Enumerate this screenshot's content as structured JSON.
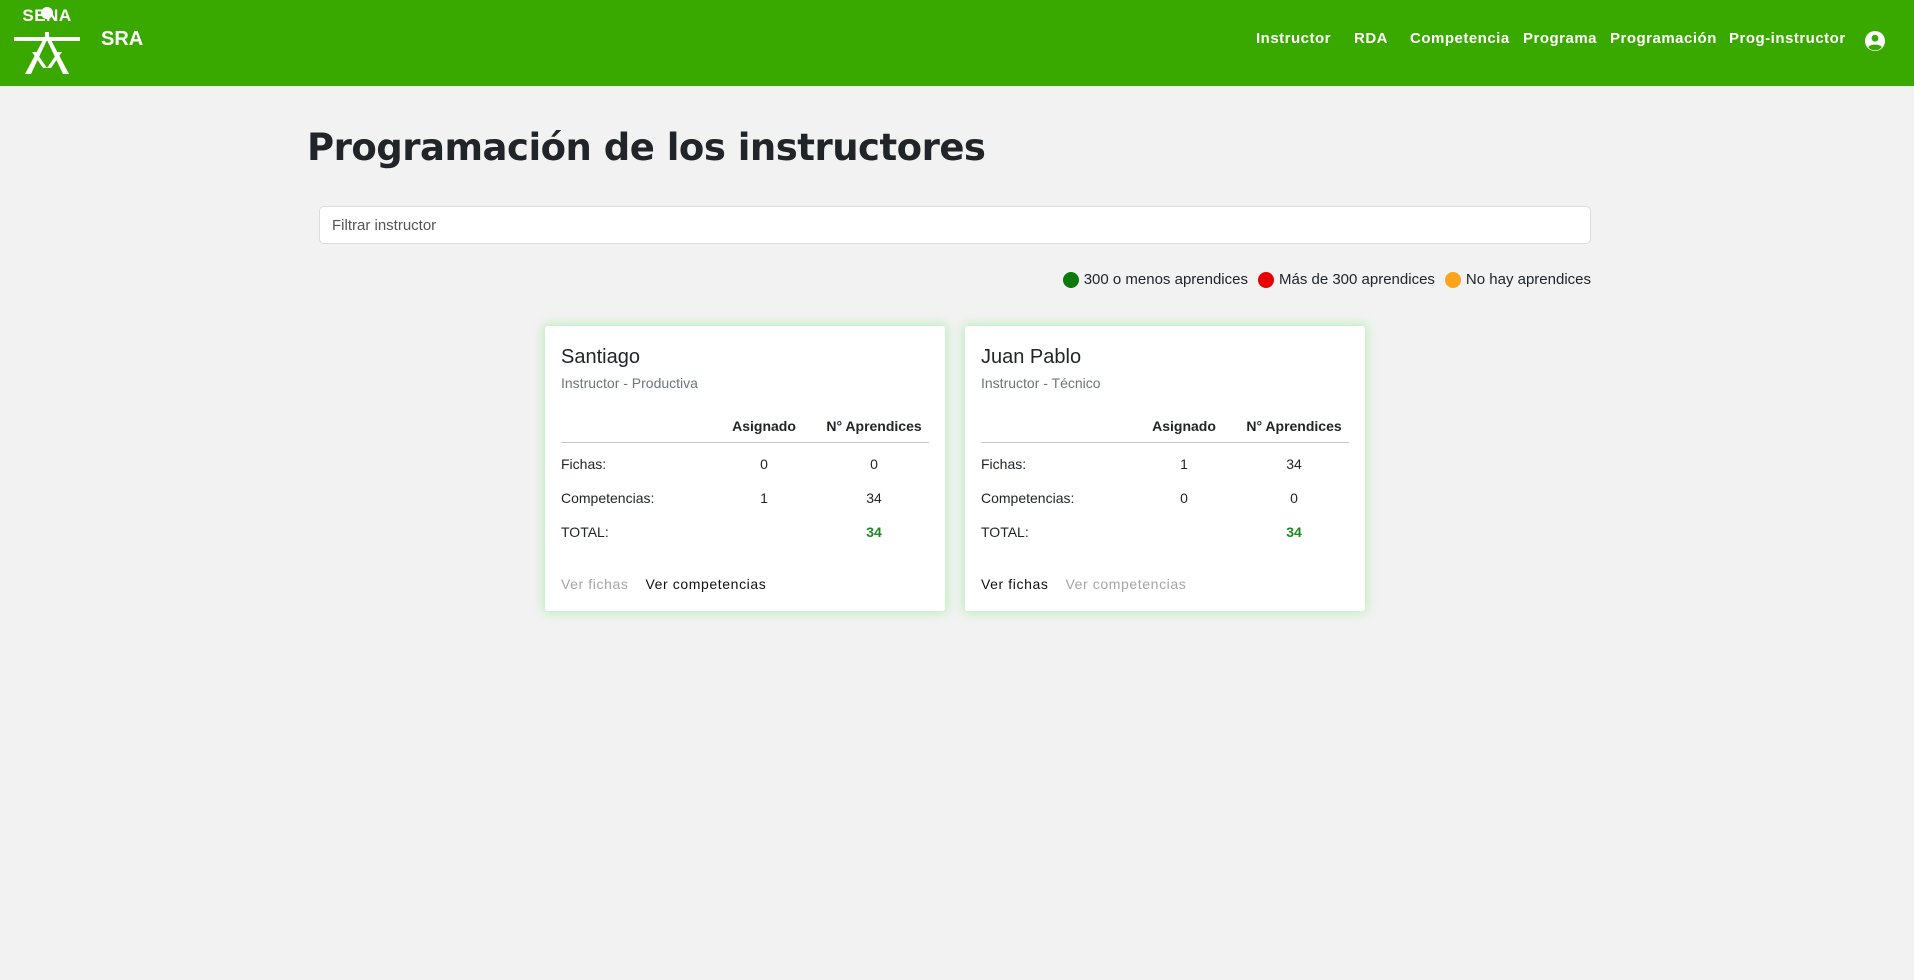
{
  "app": {
    "logo_text": "SENA",
    "brand": "SRA",
    "nav": [
      "Instructor",
      "RDA",
      "Competencia",
      "Programa",
      "Programación",
      "Prog-instructor"
    ]
  },
  "page": {
    "title": "Programación de los instructores",
    "filter_placeholder": "Filtrar instructor",
    "filter_value": ""
  },
  "legend": [
    {
      "label": "300 o menos aprendices",
      "color": "#0b7a0b"
    },
    {
      "label": "Más de 300 aprendices",
      "color": "#e80000"
    },
    {
      "label": "No hay aprendices",
      "color": "#ffa31a"
    }
  ],
  "table_headers": [
    "",
    "Asignado",
    "N° Aprendices"
  ],
  "cards": [
    {
      "name": "Santiago",
      "role": "Instructor - Productiva",
      "rows": [
        {
          "label": "Fichas:",
          "assigned": "0",
          "learners": "0"
        },
        {
          "label": "Competencias:",
          "assigned": "1",
          "learners": "34"
        },
        {
          "label": "TOTAL:",
          "assigned": "",
          "learners": "34"
        }
      ],
      "links": {
        "fichas": "Ver fichas",
        "competencias": "Ver competencias"
      },
      "fichas_enabled": false,
      "competencias_enabled": true
    },
    {
      "name": "Juan Pablo",
      "role": "Instructor - Técnico",
      "rows": [
        {
          "label": "Fichas:",
          "assigned": "1",
          "learners": "34"
        },
        {
          "label": "Competencias:",
          "assigned": "0",
          "learners": "0"
        },
        {
          "label": "TOTAL:",
          "assigned": "",
          "learners": "34"
        }
      ],
      "links": {
        "fichas": "Ver fichas",
        "competencias": "Ver competencias"
      },
      "fichas_enabled": true,
      "competencias_enabled": false
    }
  ],
  "colors": {
    "header_bg": "#39a900",
    "page_bg": "#f2f2f2",
    "total_green": "#1e8a1e"
  }
}
